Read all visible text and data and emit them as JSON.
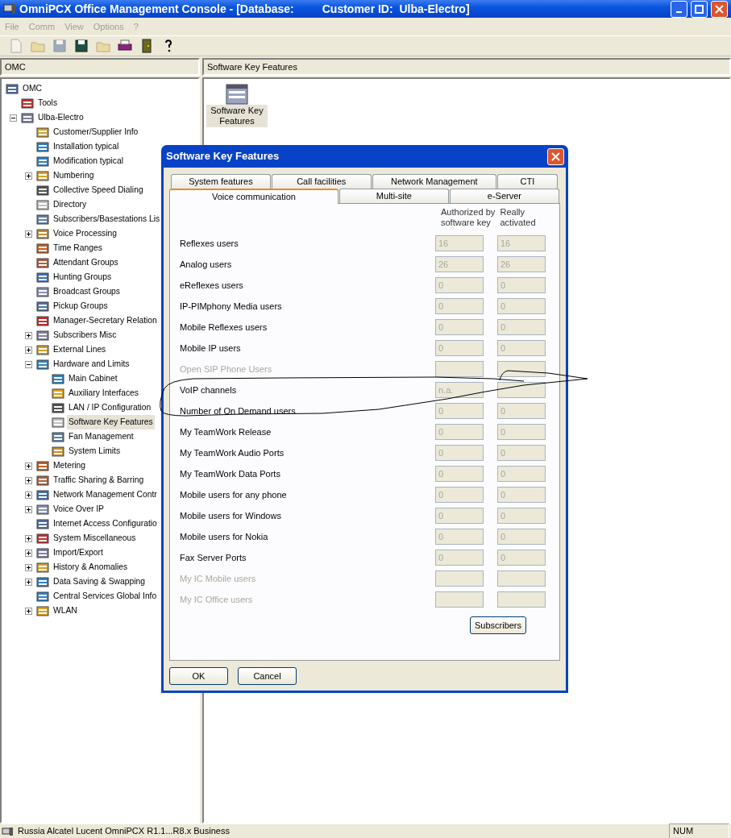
{
  "window": {
    "title": "OmniPCX Office Management Console - [Database:         Customer ID:  Ulba-Electro]"
  },
  "menu": [
    {
      "label": "File",
      "disabled": true
    },
    {
      "label": "Comm",
      "disabled": true
    },
    {
      "label": "View",
      "disabled": true
    },
    {
      "label": "Options",
      "disabled": true
    },
    {
      "label": "?",
      "disabled": true
    }
  ],
  "toolbar": [
    {
      "disabled": true
    },
    {
      "disabled": true
    },
    {
      "disabled": true
    },
    {
      "disabled": false
    },
    {
      "disabled": true
    },
    {
      "disabled": false
    },
    {
      "disabled": false
    },
    {
      "disabled": false
    }
  ],
  "left_pane": {
    "header": "OMC",
    "tree": [
      {
        "label": "OMC",
        "selected": false,
        "children": [
          {
            "label": "Tools",
            "selected": false
          },
          {
            "label": "Ulba-Electro",
            "selected": false,
            "expanded": true,
            "children": [
              {
                "label": "Customer/Supplier Info",
                "selected": false
              },
              {
                "label": "Installation typical",
                "selected": false
              },
              {
                "label": "Modification typical",
                "selected": false
              },
              {
                "label": "Numbering",
                "selected": false,
                "expanded": false
              },
              {
                "label": "Collective Speed Dialing",
                "selected": false
              },
              {
                "label": "Directory",
                "selected": false
              },
              {
                "label": "Subscribers/Basestations Lis",
                "selected": false
              },
              {
                "label": "Voice Processing",
                "selected": false,
                "expanded": false
              },
              {
                "label": "Time Ranges",
                "selected": false
              },
              {
                "label": "Attendant Groups",
                "selected": false
              },
              {
                "label": "Hunting Groups",
                "selected": false
              },
              {
                "label": "Broadcast Groups",
                "selected": false
              },
              {
                "label": "Pickup Groups",
                "selected": false
              },
              {
                "label": "Manager-Secretary Relation",
                "selected": false
              },
              {
                "label": "Subscribers Misc",
                "selected": false,
                "expanded": false
              },
              {
                "label": "External Lines",
                "selected": false,
                "expanded": false
              },
              {
                "label": "Hardware and Limits",
                "selected": false,
                "expanded": true,
                "children": [
                  {
                    "label": "Main Cabinet",
                    "selected": false
                  },
                  {
                    "label": "Auxiliary Interfaces",
                    "selected": false
                  },
                  {
                    "label": "LAN / IP Configuration",
                    "selected": false
                  },
                  {
                    "label": "Software Key Features",
                    "selected": true
                  },
                  {
                    "label": "Fan Management",
                    "selected": false
                  },
                  {
                    "label": "System Limits",
                    "selected": false
                  }
                ]
              },
              {
                "label": "Metering",
                "selected": false,
                "expanded": false
              },
              {
                "label": "Traffic Sharing & Barring",
                "selected": false,
                "expanded": false
              },
              {
                "label": "Network Management Contr",
                "selected": false,
                "expanded": false
              },
              {
                "label": "Voice Over IP",
                "selected": false,
                "expanded": false
              },
              {
                "label": "Internet Access Configuratio",
                "selected": false
              },
              {
                "label": "System Miscellaneous",
                "selected": false,
                "expanded": false
              },
              {
                "label": "Import/Export",
                "selected": false,
                "expanded": false
              },
              {
                "label": "History & Anomalies",
                "selected": false,
                "expanded": false
              },
              {
                "label": "Data Saving & Swapping",
                "selected": false,
                "expanded": false
              },
              {
                "label": "Central Services Global Info",
                "selected": false
              },
              {
                "label": "WLAN",
                "selected": false,
                "expanded": false
              }
            ]
          }
        ]
      }
    ]
  },
  "right_pane": {
    "header": "Software Key Features",
    "items": [
      {
        "label": "Software Key Features",
        "selected": true
      }
    ]
  },
  "dialog": {
    "title": "Software Key Features",
    "tab_rows": [
      [
        {
          "label": "System features",
          "selected": false
        },
        {
          "label": "Call facilities",
          "selected": false
        },
        {
          "label": "Network Management",
          "selected": false
        },
        {
          "label": "CTI",
          "selected": false
        }
      ],
      [
        {
          "label": "Voice communication",
          "selected": true
        },
        {
          "label": "Multi-site",
          "selected": false
        },
        {
          "label": "e-Server",
          "selected": false
        }
      ]
    ],
    "columns": [
      "Authorized by software key",
      "Really activated"
    ],
    "rows": [
      {
        "label": "Reflexes users",
        "disabled": false,
        "authorized": "16",
        "activated": "16"
      },
      {
        "label": "Analog users",
        "disabled": false,
        "authorized": "26",
        "activated": "26"
      },
      {
        "label": "eReflexes users",
        "disabled": false,
        "authorized": "0",
        "activated": "0"
      },
      {
        "label": "IP-PIMphony Media users",
        "disabled": false,
        "authorized": "0",
        "activated": "0"
      },
      {
        "label": "Mobile Reflexes users",
        "disabled": false,
        "authorized": "0",
        "activated": "0"
      },
      {
        "label": "Mobile IP users",
        "disabled": false,
        "authorized": "0",
        "activated": "0"
      },
      {
        "label": "Open SIP Phone Users",
        "disabled": true
      },
      {
        "label": "VoIP channels",
        "disabled": false,
        "authorized": "n.a."
      },
      {
        "label": "Number of On Demand users",
        "disabled": false,
        "authorized": "0",
        "activated": "0"
      },
      {
        "label": "My TeamWork Release",
        "disabled": false,
        "authorized": "0",
        "activated": "0"
      },
      {
        "label": "My TeamWork Audio Ports",
        "disabled": false,
        "authorized": "0",
        "activated": "0"
      },
      {
        "label": "My TeamWork Data Ports",
        "disabled": false,
        "authorized": "0",
        "activated": "0"
      },
      {
        "label": "Mobile users for any phone",
        "disabled": false,
        "authorized": "0",
        "activated": "0"
      },
      {
        "label": "Mobile users for Windows",
        "disabled": false,
        "authorized": "0",
        "activated": "0"
      },
      {
        "label": "Mobile users for Nokia",
        "disabled": false,
        "authorized": "0",
        "activated": "0"
      },
      {
        "label": "Fax Server Ports",
        "disabled": false,
        "authorized": "0",
        "activated": "0"
      },
      {
        "label": "My IC Mobile users",
        "disabled": true
      },
      {
        "label": "My IC Office users",
        "disabled": true
      }
    ],
    "panel_button": "Subscribers",
    "buttons": [
      "OK",
      "Cancel"
    ]
  },
  "status_bar": {
    "text": "Russia Alcatel Lucent OmniPCX R1.1...R8.x Business",
    "indicator": "NUM"
  }
}
